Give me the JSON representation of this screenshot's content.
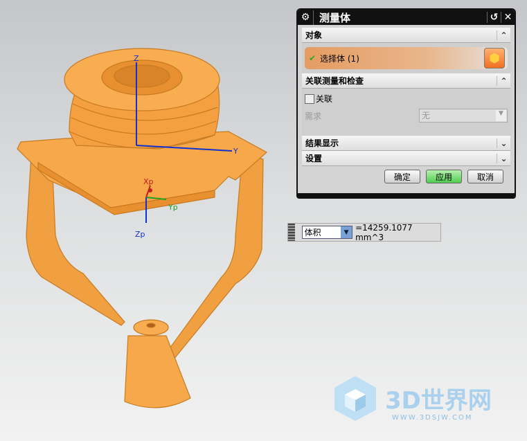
{
  "dialog": {
    "title": "测量体",
    "sections": {
      "object": "对象",
      "assoc": "关联测量和检查",
      "results": "结果显示",
      "settings": "设置"
    },
    "select_body": "选择体 (1)",
    "assoc_checkbox": "关联",
    "requirement_label": "需求",
    "requirement_value": "无",
    "buttons": {
      "ok": "确定",
      "apply": "应用",
      "cancel": "取消"
    }
  },
  "measure": {
    "type": "体积",
    "value": "=14259.1077 mm^3"
  },
  "axes": {
    "z": "Z",
    "y": "Y",
    "xp": "Xp",
    "yp": "Yp",
    "zp": "Zp"
  },
  "watermark": {
    "name": "3D世界网",
    "url": "WWW.3DSJW.COM"
  },
  "colors": {
    "part": "#f7a84a",
    "apply": "#4fcc50"
  }
}
